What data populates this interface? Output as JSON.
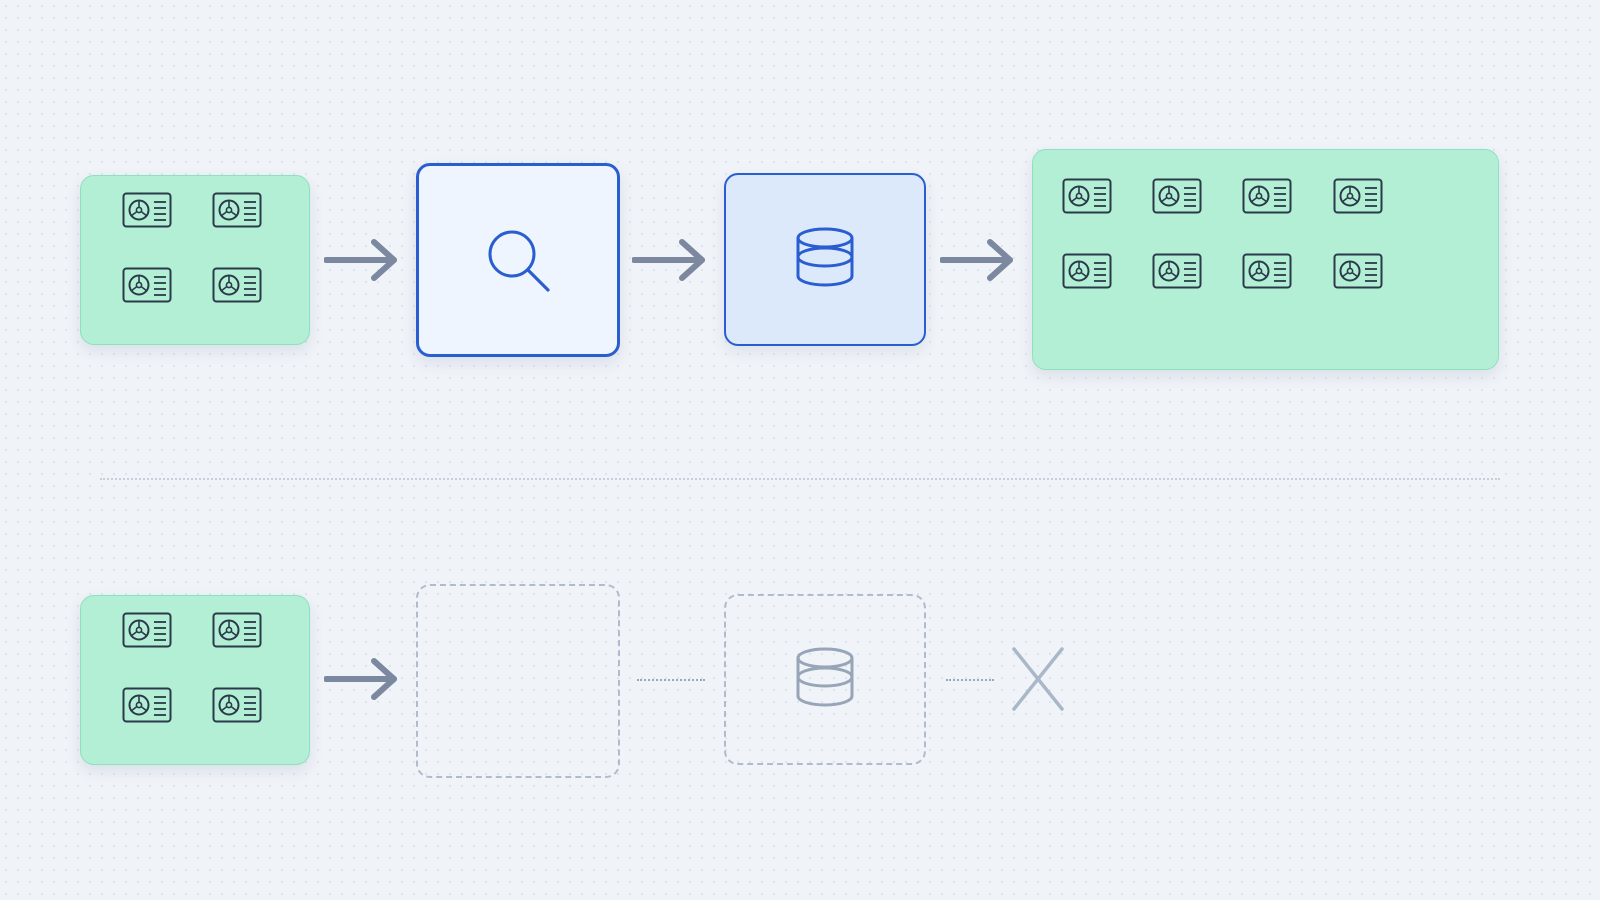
{
  "colors": {
    "card_fill": "#b3efd5",
    "card_border": "#8fe0bd",
    "accent_blue": "#2a5ed0",
    "arrow_gray": "#7b88a0",
    "ghost_gray": "#b0bccd",
    "icon_dark": "#2b3a4a"
  },
  "icons": {
    "card": "id-card-icon",
    "search": "search-icon",
    "database": "database-icon",
    "arrow": "arrow-right-icon",
    "fail": "x-mark-icon"
  },
  "diagram": {
    "top_flow": {
      "input_cards": 4,
      "steps": [
        "search",
        "database"
      ],
      "output_cards": 8
    },
    "bottom_flow": {
      "input_cards": 4,
      "steps": [
        "missing-search",
        "database"
      ],
      "result": "failure"
    }
  }
}
